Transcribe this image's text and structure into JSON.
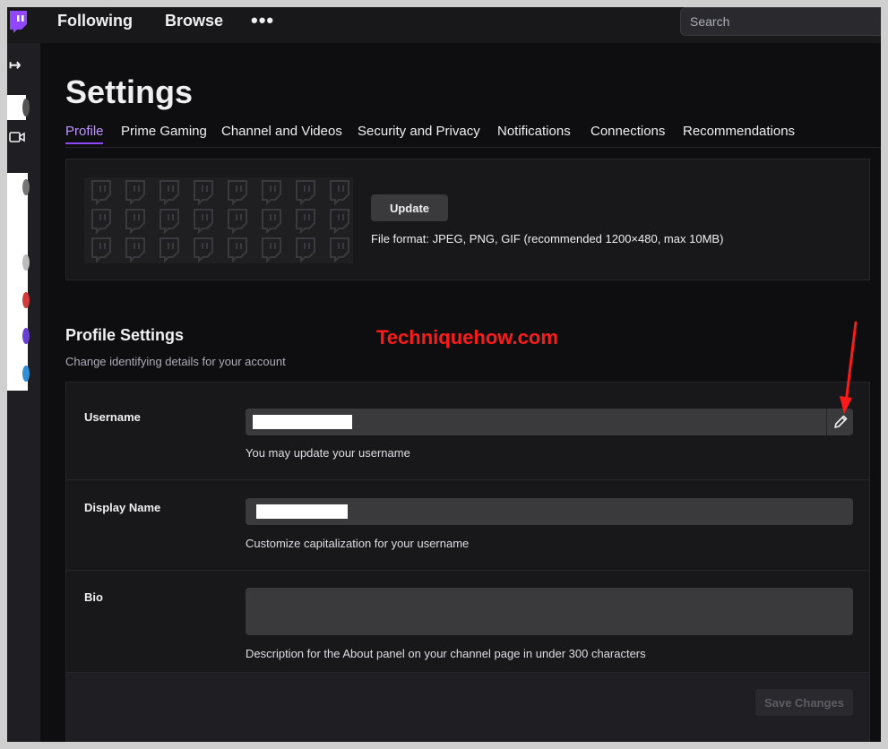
{
  "nav": {
    "following": "Following",
    "browse": "Browse",
    "more": "•••",
    "search_placeholder": "Search"
  },
  "page": {
    "title": "Settings"
  },
  "tabs": [
    {
      "label": "Profile",
      "active": true
    },
    {
      "label": "Prime Gaming",
      "active": false
    },
    {
      "label": "Channel and Videos",
      "active": false
    },
    {
      "label": "Security and Privacy",
      "active": false
    },
    {
      "label": "Notifications",
      "active": false
    },
    {
      "label": "Connections",
      "active": false
    },
    {
      "label": "Recommendations",
      "active": false
    }
  ],
  "banner": {
    "update_label": "Update",
    "file_format": "File format: JPEG, PNG, GIF (recommended 1200×480, max 10MB)"
  },
  "profile_settings": {
    "title": "Profile Settings",
    "subtitle": "Change identifying details for your account",
    "watermark": "Techniquehow.com",
    "fields": {
      "username": {
        "label": "Username",
        "help": "You may update your username"
      },
      "display_name": {
        "label": "Display Name",
        "help": "Customize capitalization for your username"
      },
      "bio": {
        "label": "Bio",
        "help": "Description for the About panel on your channel page in under 300 characters"
      }
    },
    "save_label": "Save Changes"
  },
  "colors": {
    "accent": "#9147ff",
    "active_tab": "#bf94ff",
    "background": "#0e0e10",
    "card": "#18181b",
    "annotation": "#ff1a1a"
  },
  "icons": {
    "logo": "twitch-logo-icon",
    "collapse": "collapse-arrow-icon",
    "camera": "video-camera-icon",
    "edit": "pencil-icon"
  }
}
